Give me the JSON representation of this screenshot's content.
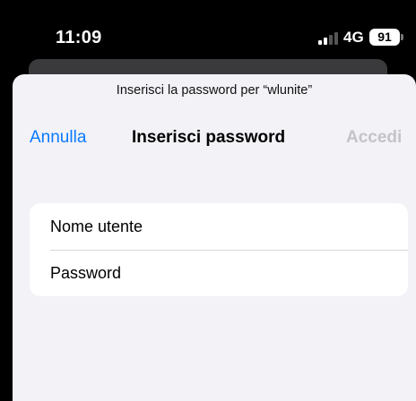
{
  "status_bar": {
    "time": "11:09",
    "network": "4G",
    "battery": "91",
    "signal_bars_active": 2,
    "signal_bars_total": 4
  },
  "sheet": {
    "prompt": "Inserisci la password per “wlunite”",
    "cancel_label": "Annulla",
    "title": "Inserisci password",
    "login_label": "Accedi",
    "username_placeholder": "Nome utente",
    "password_placeholder": "Password"
  },
  "colors": {
    "accent": "#0a7aff",
    "disabled": "#c4c4c8",
    "sheet_background": "#f2f2f7",
    "status_background": "#000000"
  }
}
